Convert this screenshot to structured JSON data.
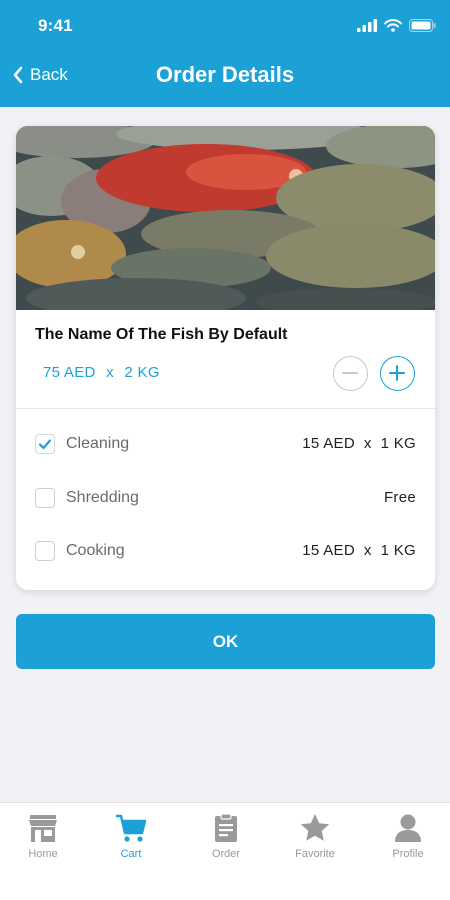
{
  "status_bar": {
    "time": "9:41"
  },
  "header": {
    "back_label": "Back",
    "title": "Order Details"
  },
  "product": {
    "name": "The Name Of The Fish By Default",
    "price": "75 AED",
    "separator": "x",
    "quantity": "2 KG"
  },
  "options": [
    {
      "label": "Cleaning",
      "price": "15 AED  x  1 KG",
      "checked": true
    },
    {
      "label": "Shredding",
      "price": "Free",
      "checked": false
    },
    {
      "label": "Cooking",
      "price": "15 AED  x  1 KG",
      "checked": false
    }
  ],
  "ok_button": {
    "label": "OK"
  },
  "tabs": [
    {
      "label": "Home",
      "icon": "store-icon",
      "active": false
    },
    {
      "label": "Cart",
      "icon": "cart-icon",
      "active": true
    },
    {
      "label": "Order",
      "icon": "clipboard-icon",
      "active": false
    },
    {
      "label": "Favorite",
      "icon": "star-icon",
      "active": false
    },
    {
      "label": "Profile",
      "icon": "person-icon",
      "active": false
    }
  ],
  "colors": {
    "primary": "#1ba1d6",
    "inactive": "#9a9a9a",
    "background": "#f2f2f6"
  }
}
